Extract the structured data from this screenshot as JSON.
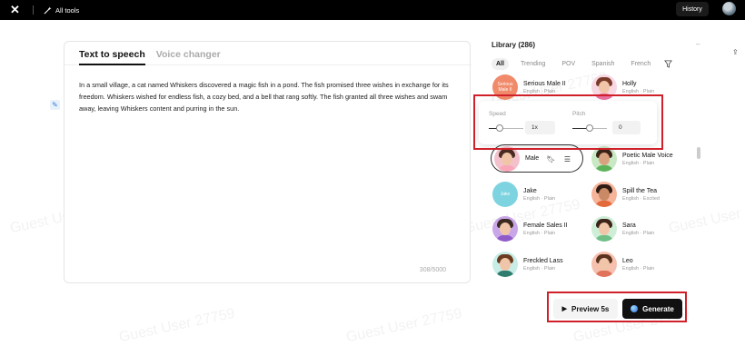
{
  "topbar": {
    "all_tools_label": "All tools",
    "history_label": "History"
  },
  "editor": {
    "tabs": [
      {
        "label": "Text to speech",
        "active": true
      },
      {
        "label": "Voice changer",
        "active": false
      }
    ],
    "text": "In a small village, a cat named Whiskers discovered a magic fish in a pond. The fish promised three wishes in exchange for its freedom. Whiskers wished for endless fish, a cozy bed, and a bell that rang softly. The fish granted all three wishes and swam away, leaving Whiskers content and purring in the sun.",
    "counter": "308/5000"
  },
  "library": {
    "title": "Library (286)",
    "filters": [
      "All",
      "Trending",
      "POV",
      "Spanish",
      "French"
    ],
    "active_filter": "All",
    "voices": [
      {
        "name": "Serious Male II",
        "meta": "English · Plain",
        "badge": "Serious Male II"
      },
      {
        "name": "Holly",
        "meta": "English · Plain"
      },
      {
        "name": "Male",
        "meta": ""
      },
      {
        "name": "Poetic Male Voice",
        "meta": "English · Plain"
      },
      {
        "name": "Jake",
        "meta": "English · Plain",
        "badge": "Jake"
      },
      {
        "name": "Spill the Tea",
        "meta": "English · Excited"
      },
      {
        "name": "Female Sales II",
        "meta": "English · Plain"
      },
      {
        "name": "Sara",
        "meta": "English · Plain"
      },
      {
        "name": "Freckled Lass",
        "meta": "English · Plain"
      },
      {
        "name": "Leo",
        "meta": "English · Plain"
      }
    ]
  },
  "settings": {
    "speed_label": "Speed",
    "speed_value": "1x",
    "pitch_label": "Pitch",
    "pitch_value": "0"
  },
  "actions": {
    "preview_label": "Preview 5s",
    "generate_label": "Generate"
  },
  "watermark": "Guest User 27759",
  "colors": {
    "highlight": "#d0202a",
    "primary": "#111111"
  }
}
